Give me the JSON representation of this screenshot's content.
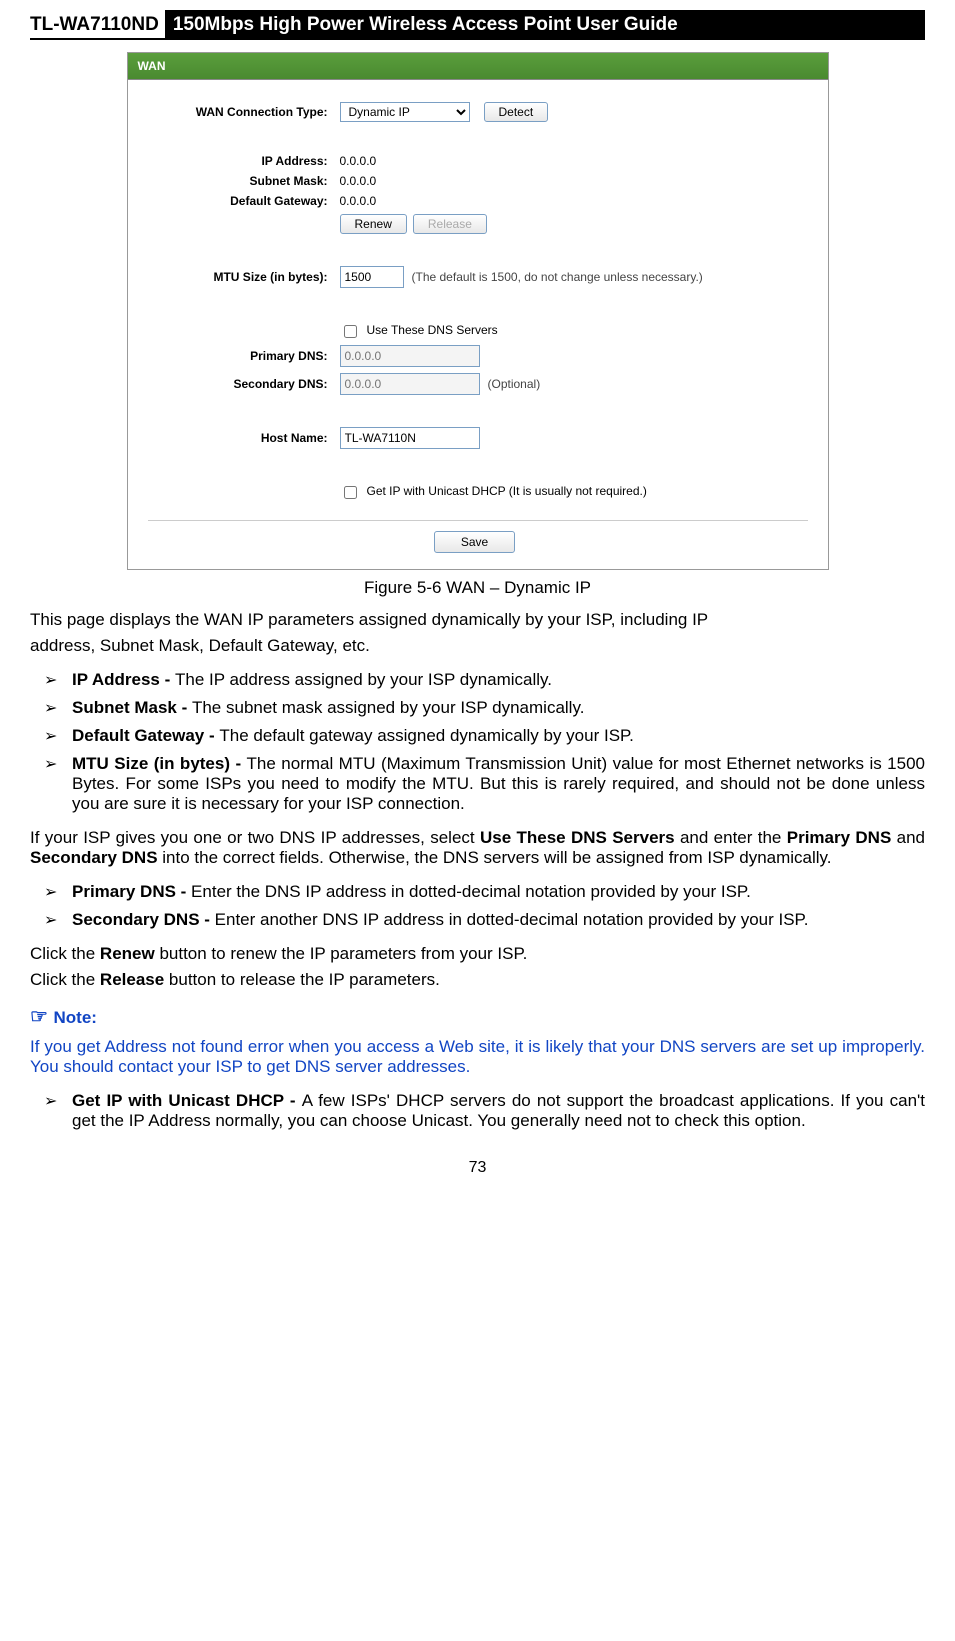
{
  "header": {
    "model": "TL-WA7110ND",
    "title": "150Mbps High Power Wireless Access Point User Guide"
  },
  "titlebar": "WAN",
  "form": {
    "conn_label": "WAN Connection Type:",
    "conn_value": "Dynamic IP",
    "detect": "Detect",
    "ip_label": "IP Address:",
    "ip_value": "0.0.0.0",
    "mask_label": "Subnet Mask:",
    "mask_value": "0.0.0.0",
    "gw_label": "Default Gateway:",
    "gw_value": "0.0.0.0",
    "renew": "Renew",
    "release": "Release",
    "mtu_label": "MTU Size (in bytes):",
    "mtu_value": "1500",
    "mtu_hint": "(The default is 1500, do not change unless necessary.)",
    "use_dns": "Use These DNS Servers",
    "pdns_label": "Primary DNS:",
    "pdns_ph": "0.0.0.0",
    "sdns_label": "Secondary DNS:",
    "sdns_ph": "0.0.0.0",
    "sdns_hint": "(Optional)",
    "host_label": "Host Name:",
    "host_value": "TL-WA7110N",
    "unicast": "Get IP with Unicast DHCP (It is usually not required.)",
    "save": "Save"
  },
  "caption": "Figure 5-6 WAN – Dynamic IP",
  "intro1": "This page displays the WAN IP parameters assigned dynamically by your ISP, including IP",
  "intro2": "address, Subnet Mask, Default Gateway, etc.",
  "li1b": "IP Address - ",
  "li1": "The IP address assigned by your ISP dynamically.",
  "li2b": "Subnet Mask - ",
  "li2": "The subnet mask assigned by your ISP dynamically.",
  "li3b": "Default Gateway - ",
  "li3": "The default gateway assigned dynamically by your ISP.",
  "li4b": "MTU Size (in bytes) - ",
  "li4": "The normal MTU (Maximum Transmission Unit) value for most Ethernet networks is 1500 Bytes. For some ISPs you need to modify the MTU. But this is rarely required, and should not be done unless you are sure it is necessary for your ISP connection.",
  "dnspara_a": "If your ISP gives you one or two DNS IP addresses, select ",
  "dnspara_b": "Use These DNS Servers",
  "dnspara_c": " and enter the ",
  "dnspara_d": "Primary DNS",
  "dnspara_e": " and ",
  "dnspara_f": "Secondary DNS",
  "dnspara_g": " into the correct fields. Otherwise, the DNS servers will be assigned from ISP dynamically.",
  "li5b": "Primary DNS - ",
  "li5": "Enter the DNS IP address in dotted-decimal notation provided by your ISP.",
  "li6b": "Secondary DNS - ",
  "li6": "Enter another DNS IP address in dotted-decimal notation provided by your ISP.",
  "renew_a": "Click the ",
  "renew_b": "Renew",
  "renew_c": " button to renew the IP parameters from your ISP.",
  "release_a": "Click the ",
  "release_b": "Release",
  "release_c": " button to release the IP parameters.",
  "note_head": "Note:",
  "note_body": "If you get Address not found error when you access a Web site, it is likely that your DNS servers are set up improperly. You should contact your ISP to get DNS server addresses.",
  "li7b": "Get IP with Unicast DHCP - ",
  "li7": "A few ISPs' DHCP servers do not support the broadcast applications. If you can't get the IP Address normally, you can choose Unicast. You generally need not to check this option.",
  "pagenum": "73"
}
